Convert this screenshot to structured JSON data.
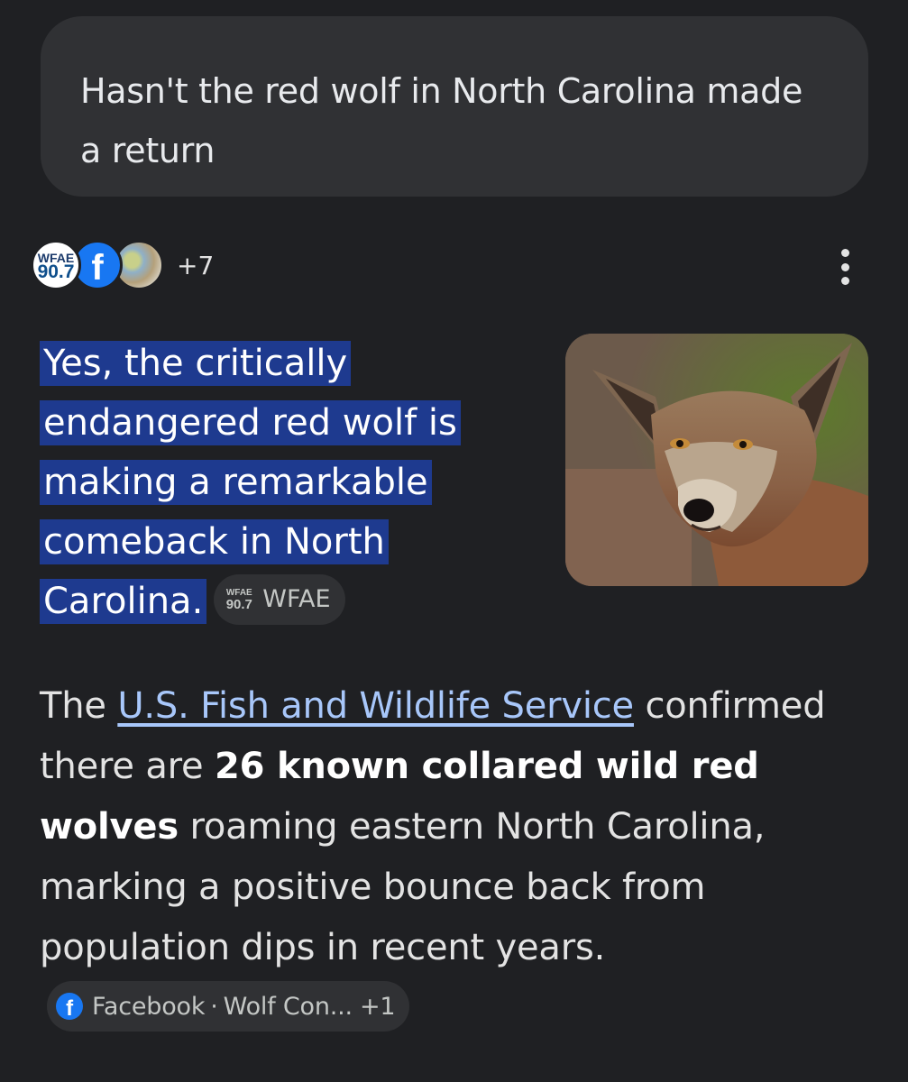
{
  "query": {
    "text": "Hasn't the red wolf in North Carolina made a return"
  },
  "sources": {
    "icons": [
      "wfae-logo",
      "facebook-icon",
      "source-thumbnail"
    ],
    "wfae_logo_top": "WFAE",
    "wfae_logo_bottom": "90.7",
    "facebook_glyph": "f",
    "more_count": "+7"
  },
  "answer": {
    "lead": "Yes, the critically endangered red wolf is making a remarkable comeback in North Carolina.",
    "lead_chip": {
      "logo_top": "WFAE",
      "logo_bottom": "90.7",
      "label": "WFAE"
    },
    "image": {
      "icon": "red-wolf-photo"
    },
    "body": {
      "prefix": "The ",
      "link": "U.S. Fish and Wildlife Service",
      "after_link": " confirmed there are ",
      "bold": "26 known collared wild red wolves",
      "after_bold": " roaming eastern North Carolina, marking a positive bounce back from population dips in recent years.",
      "chip": {
        "icon": "facebook-icon",
        "label": "Facebook",
        "separator": "·",
        "label2": "Wolf Con...",
        "more": "+1"
      }
    }
  },
  "colors": {
    "background": "#1f2023",
    "bubble": "#303134",
    "highlight": "#1e3a8f",
    "link": "#a8c7fa",
    "facebook": "#1877f2"
  }
}
